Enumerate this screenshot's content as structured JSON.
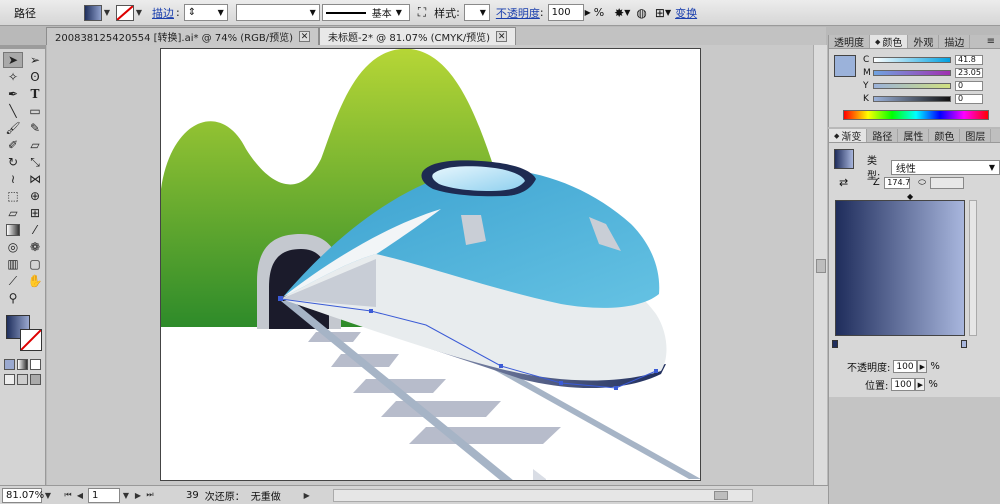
{
  "control_bar": {
    "object_type": "路径",
    "fill_color": "#2c3f6b",
    "stroke_label": "描边",
    "stroke_style": "基本",
    "style_label": "样式",
    "opacity_label": "不透明度",
    "opacity_value": "100",
    "opacity_unit": "%",
    "transform_label": "变换",
    "link_color": "#1a3fae"
  },
  "tabs": [
    {
      "label": "200838125420554 [转换].ai* @ 74% (RGB/预览)"
    },
    {
      "label": "未标题-2* @ 81.07% (CMYK/预览)"
    }
  ],
  "tools": {
    "fill_gradient_start": "#1f2f5d",
    "fill_gradient_end": "#9aa9d0",
    "icons": [
      "selection-arrow",
      "direct-select",
      "magic-wand",
      "lasso",
      "pen",
      "type",
      "line",
      "rectangle",
      "paintbrush",
      "pencil",
      "blob-brush",
      "eraser",
      "rotate",
      "scale",
      "warp",
      "width",
      "free-transform",
      "shape-builder",
      "perspective",
      "mesh",
      "gradient",
      "eyedropper",
      "blend",
      "symbol-sprayer",
      "column-graph",
      "artboard",
      "slice",
      "hand",
      "zoom"
    ]
  },
  "status_bar": {
    "zoom": "81.07%",
    "page": "1",
    "undo_count": "39",
    "undo_label": "次还原：",
    "redo_label": "无重做"
  },
  "color_panel": {
    "tabs": [
      "透明度",
      "颜色",
      "外观",
      "描边"
    ],
    "active_tab": "颜色",
    "preview_color": "#9bb2da",
    "channels": [
      {
        "label": "C",
        "value": "41.8"
      },
      {
        "label": "M",
        "value": "23.05"
      },
      {
        "label": "Y",
        "value": "0"
      },
      {
        "label": "K",
        "value": "0"
      }
    ]
  },
  "gradient_panel": {
    "tabs": [
      "渐变",
      "路径",
      "属性",
      "颜色",
      "图层"
    ],
    "active_tab": "渐变",
    "type_label": "类型:",
    "type_value": "线性",
    "angle_value": "174.7",
    "start_color": "#1f2d5c",
    "end_color": "#a8b6dd",
    "opacity_label": "不透明度:",
    "opacity_value": "100",
    "location_label": "位置:",
    "location_value": "100",
    "unit": "%"
  },
  "artwork": {
    "mountain_dark": "#2e8b2a",
    "mountain_light": "#b6d636",
    "train_blue": "#4bb1d9",
    "train_white": "#e8ecee",
    "window_color": "#a6dcf3",
    "rail_color": "#a6b4c6"
  }
}
